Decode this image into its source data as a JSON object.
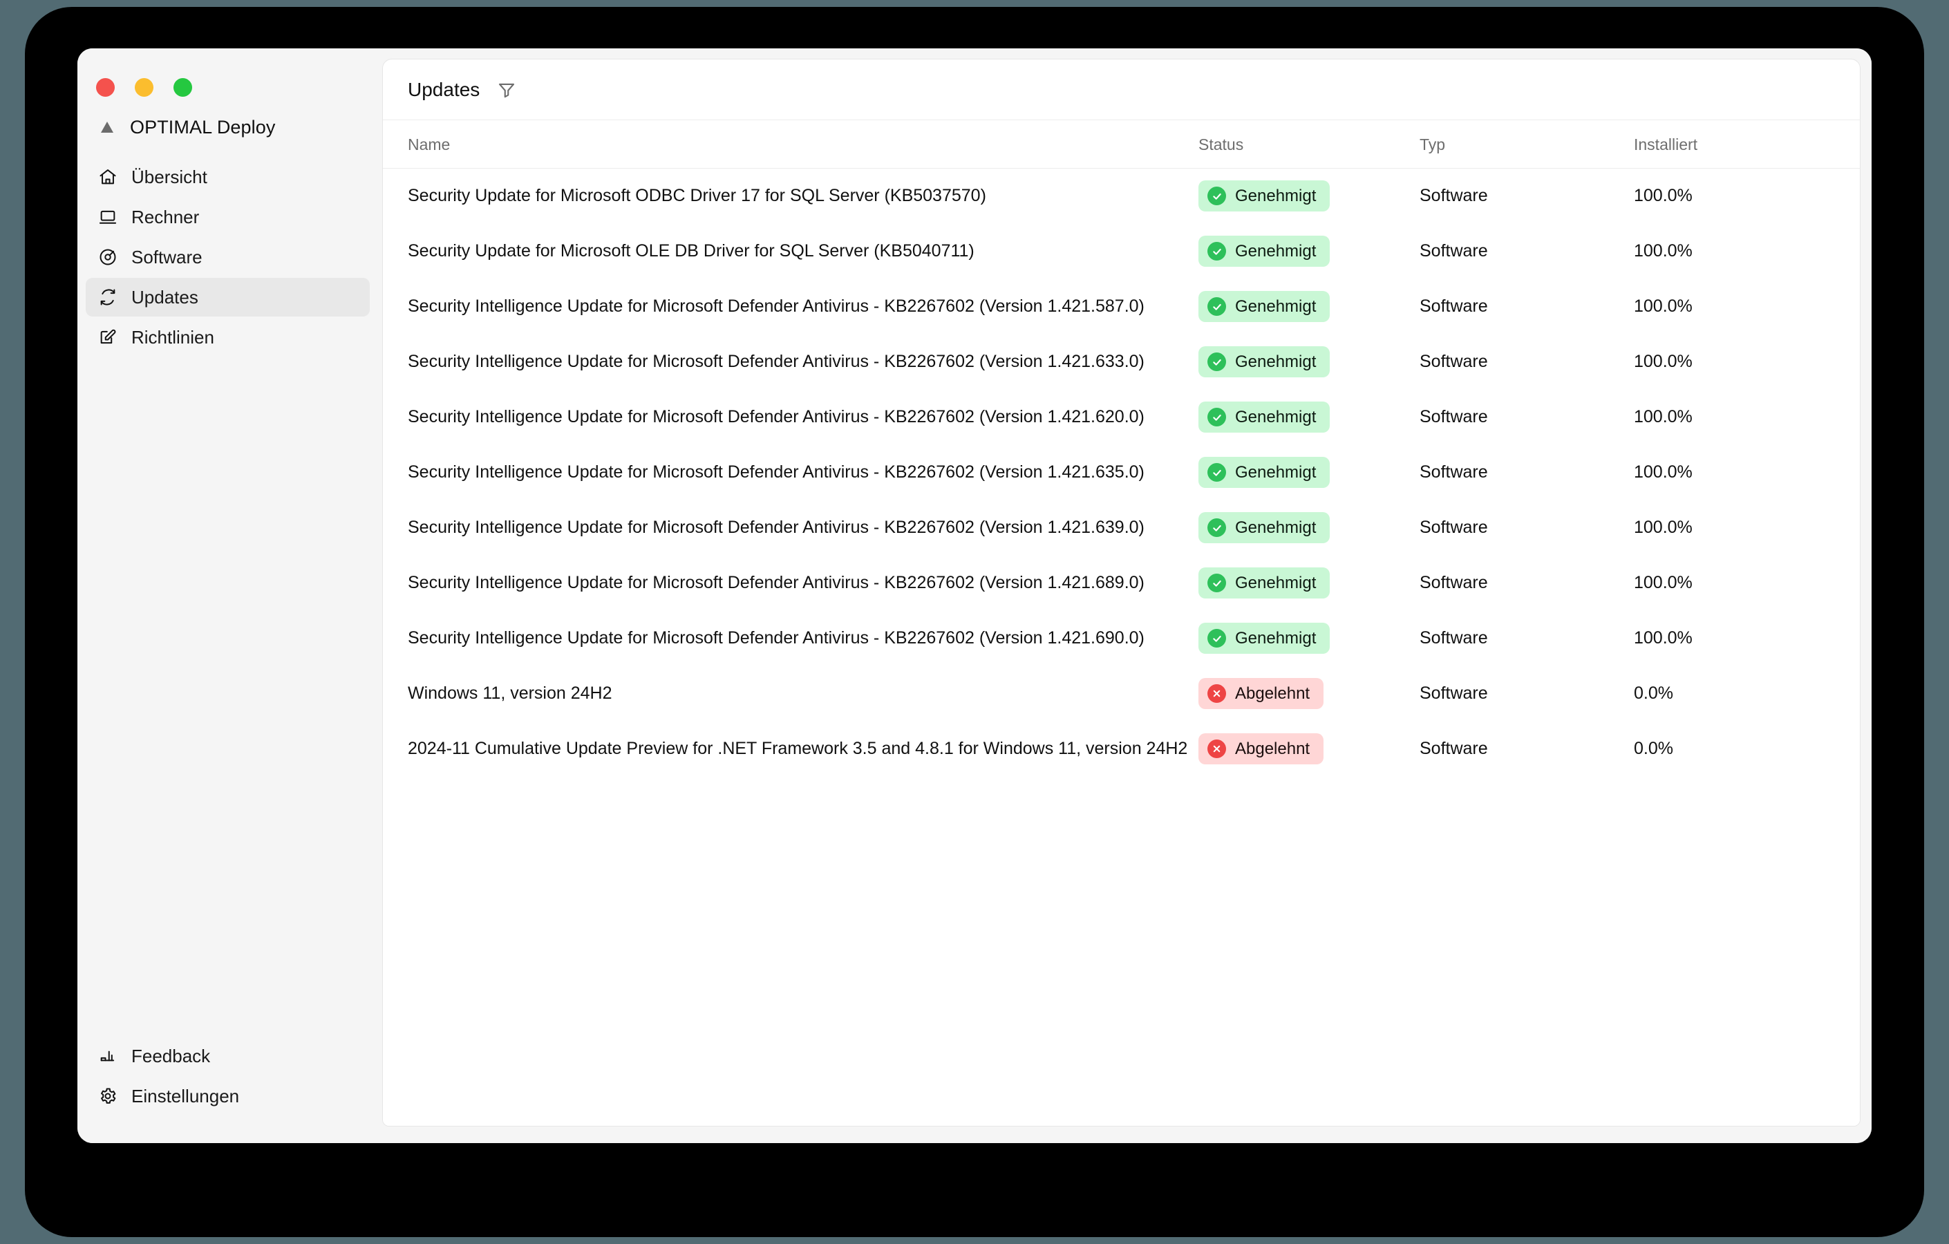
{
  "window": {
    "traffic_lights": [
      {
        "name": "close",
        "color": "#f4524d"
      },
      {
        "name": "minimize",
        "color": "#fbbd2e"
      },
      {
        "name": "maximize",
        "color": "#25c840"
      }
    ]
  },
  "sidebar": {
    "brand": {
      "label": "OPTIMAL Deploy",
      "icon": "triangle-logo-icon"
    },
    "items": [
      {
        "label": "Übersicht",
        "icon": "home-icon",
        "active": false
      },
      {
        "label": "Rechner",
        "icon": "laptop-icon",
        "active": false
      },
      {
        "label": "Software",
        "icon": "disc-icon",
        "active": false
      },
      {
        "label": "Updates",
        "icon": "refresh-icon",
        "active": true
      },
      {
        "label": "Richtlinien",
        "icon": "edit-icon",
        "active": false
      }
    ],
    "bottom_items": [
      {
        "label": "Feedback",
        "icon": "megaphone-icon"
      },
      {
        "label": "Einstellungen",
        "icon": "gear-icon"
      }
    ]
  },
  "header": {
    "title": "Updates",
    "filter_icon": "filter-icon"
  },
  "table": {
    "columns": [
      "Name",
      "Status",
      "Typ",
      "Installiert"
    ],
    "rows": [
      {
        "name": "Security Update for Microsoft ODBC Driver 17 for SQL Server (KB5037570)",
        "status": "Genehmigt",
        "status_kind": "approved",
        "typ": "Software",
        "installiert": "100.0%"
      },
      {
        "name": "Security Update for Microsoft OLE DB Driver for SQL Server (KB5040711)",
        "status": "Genehmigt",
        "status_kind": "approved",
        "typ": "Software",
        "installiert": "100.0%"
      },
      {
        "name": "Security Intelligence Update for Microsoft Defender Antivirus - KB2267602 (Version 1.421.587.0)",
        "status": "Genehmigt",
        "status_kind": "approved",
        "typ": "Software",
        "installiert": "100.0%"
      },
      {
        "name": "Security Intelligence Update for Microsoft Defender Antivirus - KB2267602 (Version 1.421.633.0)",
        "status": "Genehmigt",
        "status_kind": "approved",
        "typ": "Software",
        "installiert": "100.0%"
      },
      {
        "name": "Security Intelligence Update for Microsoft Defender Antivirus - KB2267602 (Version 1.421.620.0)",
        "status": "Genehmigt",
        "status_kind": "approved",
        "typ": "Software",
        "installiert": "100.0%"
      },
      {
        "name": "Security Intelligence Update for Microsoft Defender Antivirus - KB2267602 (Version 1.421.635.0)",
        "status": "Genehmigt",
        "status_kind": "approved",
        "typ": "Software",
        "installiert": "100.0%"
      },
      {
        "name": "Security Intelligence Update for Microsoft Defender Antivirus - KB2267602 (Version 1.421.639.0)",
        "status": "Genehmigt",
        "status_kind": "approved",
        "typ": "Software",
        "installiert": "100.0%"
      },
      {
        "name": "Security Intelligence Update for Microsoft Defender Antivirus - KB2267602 (Version 1.421.689.0)",
        "status": "Genehmigt",
        "status_kind": "approved",
        "typ": "Software",
        "installiert": "100.0%"
      },
      {
        "name": "Security Intelligence Update for Microsoft Defender Antivirus - KB2267602 (Version 1.421.690.0)",
        "status": "Genehmigt",
        "status_kind": "approved",
        "typ": "Software",
        "installiert": "100.0%"
      },
      {
        "name": "Windows 11, version 24H2",
        "status": "Abgelehnt",
        "status_kind": "rejected",
        "typ": "Software",
        "installiert": "0.0%"
      },
      {
        "name": "2024-11 Cumulative Update Preview for .NET Framework 3.5 and 4.8.1 for Windows 11, version 24H2",
        "status": "Abgelehnt",
        "status_kind": "rejected",
        "typ": "Software",
        "installiert": "0.0%"
      }
    ]
  },
  "colors": {
    "approved_bg": "#c9f7d5",
    "approved_dot": "#2ec05a",
    "rejected_bg": "#ffd6d6",
    "rejected_dot": "#ee4444",
    "sidebar_bg": "#f5f5f5",
    "active_item_bg": "#e8e8e8",
    "desktop_bg": "#526b73"
  }
}
